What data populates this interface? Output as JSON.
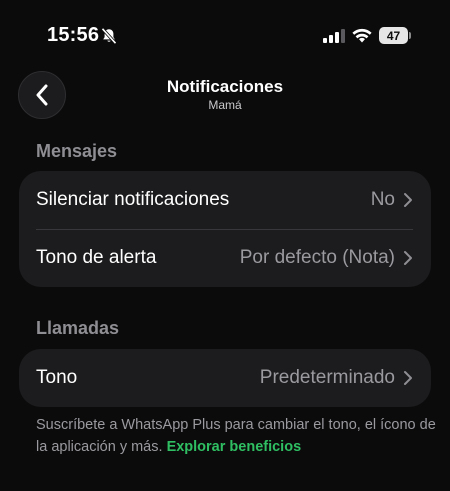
{
  "status_bar": {
    "time": "15:56",
    "battery": "47",
    "icons": [
      "bell-off-icon",
      "signal-icon",
      "wifi-icon",
      "battery-icon"
    ]
  },
  "header": {
    "back_icon": "chevron-left-icon",
    "title": "Notificaciones",
    "subtitle": "Mamá"
  },
  "sections": {
    "mensajes": {
      "title": "Mensajes",
      "rows": [
        {
          "label": "Silenciar notificaciones",
          "value": "No"
        },
        {
          "label": "Tono de alerta",
          "value": "Por defecto (Nota)"
        }
      ]
    },
    "llamadas": {
      "title": "Llamadas",
      "rows": [
        {
          "label": "Tono",
          "value": "Predeterminado"
        }
      ]
    }
  },
  "footer": {
    "text": "Suscríbete a WhatsApp Plus para cambiar el tono, el ícono de la aplicación y más.",
    "link": "Explorar beneficios"
  },
  "colors": {
    "background": "#0b0b0c",
    "card": "#1c1c1e",
    "secondary_text": "#9a9a9f",
    "accent": "#2fbf62"
  }
}
